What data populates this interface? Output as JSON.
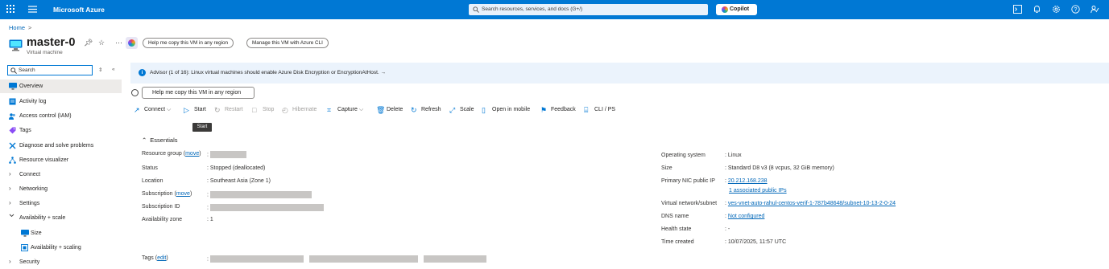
{
  "topbar": {
    "brand": "Microsoft Azure",
    "search_placeholder": "Search resources, services, and docs (G+/)",
    "copilot_label": "Copilot",
    "bg_color": "#0078d4"
  },
  "breadcrumb": {
    "home": "Home",
    "sep": ">"
  },
  "resource": {
    "title": "master-0",
    "subtitle": "Virtual machine",
    "header_buttons": [
      "Help me copy this VM in any region",
      "Manage this VM with Azure CLI"
    ]
  },
  "sidebar": {
    "search_value": "Search",
    "items": [
      {
        "label": "Overview",
        "icon": "monitor-icon",
        "active": true
      },
      {
        "label": "Activity log",
        "icon": "activity-log-icon"
      },
      {
        "label": "Access control (IAM)",
        "icon": "people-icon"
      },
      {
        "label": "Tags",
        "icon": "tag-icon"
      },
      {
        "label": "Diagnose and solve problems",
        "icon": "wrench-icon"
      },
      {
        "label": "Resource visualizer",
        "icon": "visualizer-icon"
      },
      {
        "label": "Connect",
        "icon": "chevron-right-icon"
      },
      {
        "label": "Networking",
        "icon": "chevron-right-icon"
      },
      {
        "label": "Settings",
        "icon": "chevron-right-icon"
      },
      {
        "label": "Availability + scale",
        "icon": "chevron-down-icon"
      },
      {
        "label": "Size",
        "icon": "monitor-icon"
      },
      {
        "label": "Availability + scaling",
        "icon": "scaling-icon"
      },
      {
        "label": "Security",
        "icon": "chevron-right-icon"
      }
    ]
  },
  "advisor": {
    "text": "Advisor (1 of 16): Linux virtual machines should enable Azure Disk Encryption or EncryptionAtHost.",
    "arrow": "→"
  },
  "copy_button": "Help me copy this VM in any region",
  "toolbar": {
    "items": [
      {
        "label": "Connect",
        "icon": "connect-icon",
        "enabled": true,
        "dropdown": true
      },
      {
        "label": "Start",
        "icon": "play-icon",
        "enabled": true
      },
      {
        "label": "Restart",
        "icon": "restart-icon",
        "enabled": false
      },
      {
        "label": "Stop",
        "icon": "stop-icon",
        "enabled": false
      },
      {
        "label": "Hibernate",
        "icon": "hibernate-icon",
        "enabled": false
      },
      {
        "label": "Capture",
        "icon": "capture-icon",
        "enabled": true,
        "dropdown": true
      },
      {
        "label": "Delete",
        "icon": "trash-icon",
        "enabled": true
      },
      {
        "label": "Refresh",
        "icon": "refresh-icon",
        "enabled": true
      },
      {
        "label": "Scale",
        "icon": "scale-icon",
        "enabled": true
      },
      {
        "label": "Open in mobile",
        "icon": "mobile-icon",
        "enabled": true
      },
      {
        "label": "Feedback",
        "icon": "feedback-icon",
        "enabled": true
      },
      {
        "label": "CLI / PS",
        "icon": "cli-icon",
        "enabled": true
      }
    ],
    "tooltip": "Start"
  },
  "essentials": {
    "title": "Essentials",
    "left": [
      {
        "label": "Resource group",
        "link": "move",
        "value": ""
      },
      {
        "label": "Status",
        "value": "Stopped (deallocated)"
      },
      {
        "label": "Location",
        "value": "Southeast Asia (Zone 1)"
      },
      {
        "label": "Subscription",
        "link": "move",
        "value": ""
      },
      {
        "label": "Subscription ID",
        "value": ""
      },
      {
        "label": "Availability zone",
        "value": "1"
      }
    ],
    "right": [
      {
        "label": "Operating system",
        "value": "Linux"
      },
      {
        "label": "Size",
        "value": "Standard D8 v3 (8 vcpus, 32 GiB memory)"
      },
      {
        "label": "Primary NIC public IP",
        "value": "20.212.168.238",
        "value2": "1 associated public IPs"
      },
      {
        "label": "Virtual network/subnet",
        "value": "ves-vnet-auto-rahul-centos-verif-1-787b48648/subnet-10-13-2-0-24"
      },
      {
        "label": "DNS name",
        "value": "Not configured"
      },
      {
        "label": "Health state",
        "value": "-"
      },
      {
        "label": "Time created",
        "value": "10/07/2025, 11:57 UTC"
      }
    ],
    "tags_label": "Tags",
    "tags_link": "edit"
  }
}
